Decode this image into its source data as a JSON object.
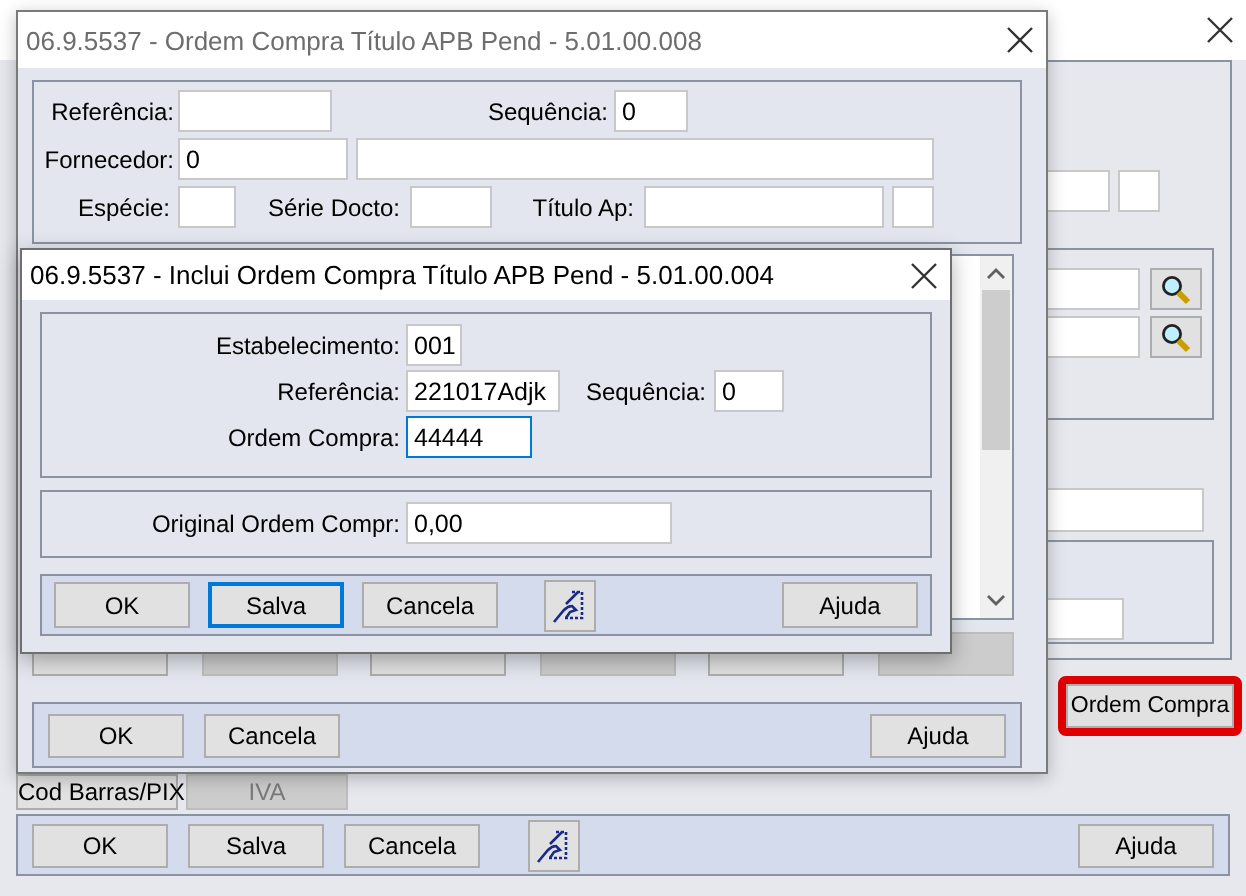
{
  "background_window": {
    "ordem_compra_button": {
      "label": "Ordem Compra",
      "highlighted": true
    },
    "extra_buttons": [
      {
        "label": "Cod Barras/PIX",
        "disabled": false
      },
      {
        "label": "IVA",
        "disabled": true
      }
    ],
    "buttons": [
      {
        "kind": "text",
        "label": "OK"
      },
      {
        "kind": "text",
        "label": "Salva"
      },
      {
        "kind": "text",
        "label": "Cancela"
      },
      {
        "kind": "icon"
      },
      {
        "kind": "text",
        "label": "Ajuda"
      }
    ]
  },
  "main_window": {
    "title": "06.9.5537 - Ordem Compra Título APB Pend - 5.01.00.008",
    "filter_rows": [
      [
        {
          "kind": "labeled",
          "label": "Referência:"
        },
        {
          "kind": "labeled",
          "label": "Sequência:",
          "value": "0"
        }
      ],
      [
        {
          "kind": "labeled",
          "label": "Fornecedor:",
          "value": "0"
        },
        {
          "kind": "plain"
        }
      ],
      [
        {
          "kind": "labeled",
          "label": "Espécie:"
        },
        {
          "kind": "labeled",
          "label": "Série Docto:"
        },
        {
          "kind": "labeled",
          "label": "Título Ap:"
        },
        {
          "kind": "plain"
        }
      ]
    ],
    "action_buttons": [
      {
        "disabled": false
      },
      {
        "disabled": true
      },
      {
        "disabled": false
      },
      {
        "disabled": true
      },
      {
        "disabled": false
      },
      {
        "disabled": true
      }
    ],
    "buttons": [
      {
        "kind": "text",
        "label": "OK"
      },
      {
        "kind": "text",
        "label": "Cancela"
      },
      {
        "kind": "text",
        "label": "Ajuda"
      }
    ]
  },
  "inclui_dialog": {
    "title": "06.9.5537 - Inclui Ordem Compra Título APB Pend - 5.01.00.004",
    "fields": [
      {
        "label": "Estabelecimento:",
        "value": "001",
        "focused": false
      },
      {
        "label": "Referência:",
        "value": "221017Adjk",
        "focused": false
      },
      {
        "label": "Sequência:",
        "value": "0",
        "focused": false
      },
      {
        "label": "Ordem Compra:",
        "value": "44444",
        "focused": true
      }
    ],
    "original_field": {
      "label": "Original Ordem Compr:",
      "value": "0,00"
    },
    "buttons": [
      {
        "kind": "text",
        "label": "OK",
        "default": false
      },
      {
        "kind": "text",
        "label": "Salva",
        "default": true
      },
      {
        "kind": "text",
        "label": "Cancela",
        "default": false
      },
      {
        "kind": "icon"
      },
      {
        "kind": "text",
        "label": "Ajuda",
        "default": false
      }
    ]
  }
}
